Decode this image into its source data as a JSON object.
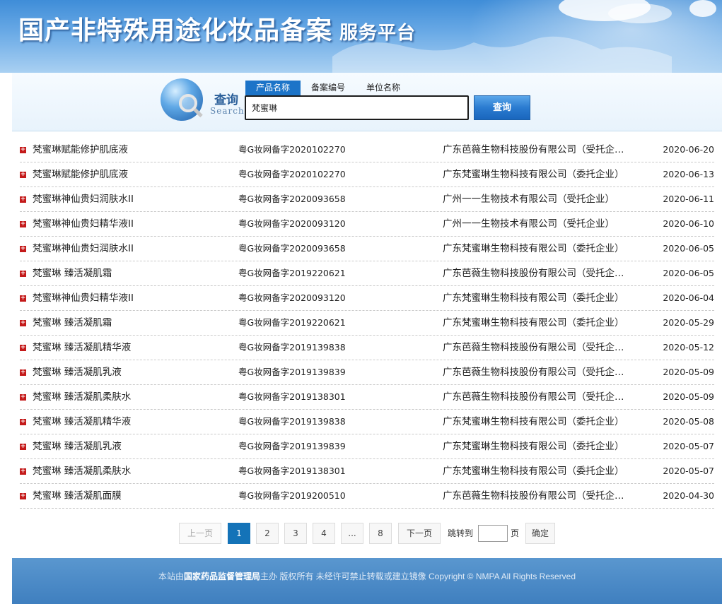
{
  "header": {
    "title": "国产非特殊用途化妆品备案",
    "subtitle": "服务平台"
  },
  "search": {
    "icon_label_cn": "查询",
    "icon_label_en": "Search",
    "tabs": [
      {
        "label": "产品名称",
        "active": true
      },
      {
        "label": "备案编号",
        "active": false
      },
      {
        "label": "单位名称",
        "active": false
      }
    ],
    "query": "梵蜜琳",
    "button_label": "查询"
  },
  "results": [
    {
      "name": "梵蜜琳赋能修护肌底液",
      "record_no": "粤G妆网备字2020102270",
      "company": "广东芭薇生物科技股份有限公司（受托企…",
      "date": "2020-06-20"
    },
    {
      "name": "梵蜜琳赋能修护肌底液",
      "record_no": "粤G妆网备字2020102270",
      "company": "广东梵蜜琳生物科技有限公司（委托企业）",
      "date": "2020-06-13"
    },
    {
      "name": "梵蜜琳神仙贵妇润肤水II",
      "record_no": "粤G妆网备字2020093658",
      "company": "广州一一生物技术有限公司（受托企业）",
      "date": "2020-06-11"
    },
    {
      "name": "梵蜜琳神仙贵妇精华液II",
      "record_no": "粤G妆网备字2020093120",
      "company": "广州一一生物技术有限公司（受托企业）",
      "date": "2020-06-10"
    },
    {
      "name": "梵蜜琳神仙贵妇润肤水II",
      "record_no": "粤G妆网备字2020093658",
      "company": "广东梵蜜琳生物科技有限公司（委托企业）",
      "date": "2020-06-05"
    },
    {
      "name": "梵蜜琳 臻活凝肌霜",
      "record_no": "粤G妆网备字2019220621",
      "company": "广东芭薇生物科技股份有限公司（受托企…",
      "date": "2020-06-05"
    },
    {
      "name": "梵蜜琳神仙贵妇精华液II",
      "record_no": "粤G妆网备字2020093120",
      "company": "广东梵蜜琳生物科技有限公司（委托企业）",
      "date": "2020-06-04"
    },
    {
      "name": "梵蜜琳 臻活凝肌霜",
      "record_no": "粤G妆网备字2019220621",
      "company": "广东梵蜜琳生物科技有限公司（委托企业）",
      "date": "2020-05-29"
    },
    {
      "name": "梵蜜琳 臻活凝肌精华液",
      "record_no": "粤G妆网备字2019139838",
      "company": "广东芭薇生物科技股份有限公司（受托企…",
      "date": "2020-05-12"
    },
    {
      "name": "梵蜜琳 臻活凝肌乳液",
      "record_no": "粤G妆网备字2019139839",
      "company": "广东芭薇生物科技股份有限公司（受托企…",
      "date": "2020-05-09"
    },
    {
      "name": "梵蜜琳 臻活凝肌柔肤水",
      "record_no": "粤G妆网备字2019138301",
      "company": "广东芭薇生物科技股份有限公司（受托企…",
      "date": "2020-05-09"
    },
    {
      "name": "梵蜜琳 臻活凝肌精华液",
      "record_no": "粤G妆网备字2019139838",
      "company": "广东梵蜜琳生物科技有限公司（委托企业）",
      "date": "2020-05-08"
    },
    {
      "name": "梵蜜琳 臻活凝肌乳液",
      "record_no": "粤G妆网备字2019139839",
      "company": "广东梵蜜琳生物科技有限公司（委托企业）",
      "date": "2020-05-07"
    },
    {
      "name": "梵蜜琳 臻活凝肌柔肤水",
      "record_no": "粤G妆网备字2019138301",
      "company": "广东梵蜜琳生物科技有限公司（委托企业）",
      "date": "2020-05-07"
    },
    {
      "name": "梵蜜琳 臻活凝肌面膜",
      "record_no": "粤G妆网备字2019200510",
      "company": "广东芭薇生物科技股份有限公司（受托企…",
      "date": "2020-04-30"
    }
  ],
  "pagination": {
    "prev_label": "上一页",
    "pages": [
      "1",
      "2",
      "3",
      "4"
    ],
    "current_page": "1",
    "ellipsis": "...",
    "last_page": "8",
    "next_label": "下一页",
    "jump_label": "跳转到",
    "page_unit": "页",
    "confirm_label": "确定"
  },
  "footer": {
    "prefix": "本站由",
    "org": "国家药品监督管理局",
    "suffix": "主办 版权所有 未经许可禁止转载或建立镜像 Copyright © NMPA All Rights Reserved"
  },
  "colors": {
    "accent": "#1c74c8",
    "bullet": "#c41a1a",
    "footer_bg": "#4a88c5",
    "pager_active": "#1473b8"
  }
}
